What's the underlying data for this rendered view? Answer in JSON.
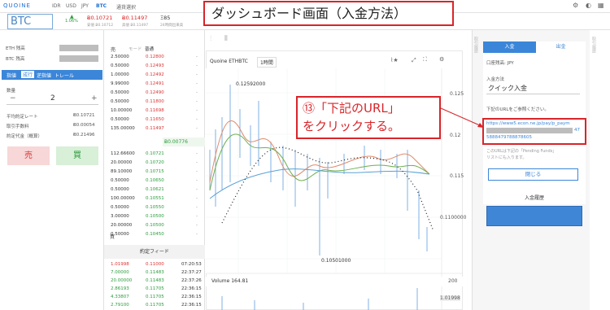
{
  "header": {
    "logo": "QUOINE",
    "currencies": [
      "IDR",
      "USD",
      "JPY",
      "BTC"
    ],
    "pair_select": "通貨選択"
  },
  "ticker": {
    "symbol": "BTC",
    "change": "1.06%",
    "bid": "Ƀ0.10721",
    "ask": "Ƀ0.11497",
    "volume": "Ξ85",
    "bid_sub": "安値 Ƀ0.10712",
    "ask_sub": "高値 Ƀ0.11497",
    "vol_sub": "24時間出来高"
  },
  "annotation_title": "ダッシュボード画面（入金方法）",
  "annotation_13": [
    "⑬「下記のURL」",
    "をクリックする。"
  ],
  "balances": {
    "eth_label": "ETH 残高",
    "btc_label": "BTC 残高"
  },
  "order_tabs": [
    "指値",
    "成行",
    "逆指値",
    "トレール"
  ],
  "quantity": {
    "label": "数量",
    "minus": "−",
    "value": "2",
    "plus": "+"
  },
  "summary": [
    {
      "label": "平均約定レート",
      "value": "Ƀ0.10721"
    },
    {
      "label": "取引手数料",
      "value": "Ƀ0.00054"
    },
    {
      "label": "約定代金（概算）",
      "value": "Ƀ0.21496"
    }
  ],
  "buttons": {
    "sell": "売",
    "buy": "買"
  },
  "orderbook": {
    "sell_label": "売",
    "mode_label": "モード",
    "mode_value": "普通",
    "asks": [
      [
        "2.50000",
        "0.12800"
      ],
      [
        "0.50000",
        "0.12493"
      ],
      [
        "1.00000",
        "0.12492"
      ],
      [
        "9.99000",
        "0.12491"
      ],
      [
        "0.50000",
        "0.12490"
      ],
      [
        "0.50000",
        "0.11800"
      ],
      [
        "10.00000",
        "0.11698"
      ],
      [
        "0.50000",
        "0.11650"
      ],
      [
        "135.00000",
        "0.11497"
      ]
    ],
    "mid": "Ƀ0.00776",
    "bids": [
      [
        "112.66600",
        "0.10721"
      ],
      [
        "20.00000",
        "0.10720"
      ],
      [
        "89.10000",
        "0.10715"
      ],
      [
        "0.50000",
        "0.10650"
      ],
      [
        "0.50000",
        "0.10621"
      ],
      [
        "100.00000",
        "0.10551"
      ],
      [
        "0.50000",
        "0.10550"
      ],
      [
        "3.00000",
        "0.10500"
      ],
      [
        "20.00000",
        "0.10500"
      ],
      [
        "0.50000",
        "0.10450"
      ]
    ],
    "buy_label": "買"
  },
  "feed": {
    "header": "約定フィード",
    "rows": [
      [
        "1.01998",
        "0.11000",
        "07:20:53",
        "sell"
      ],
      [
        "7.00000",
        "0.11483",
        "22:37:27",
        "buy"
      ],
      [
        "20.00000",
        "0.11483",
        "22:37:26",
        "buy"
      ],
      [
        "2.86193",
        "0.11705",
        "22:36:15",
        "buy"
      ],
      [
        "4.33807",
        "0.11705",
        "22:36:15",
        "buy"
      ],
      [
        "2.79100",
        "0.11705",
        "22:36:15",
        "buy"
      ]
    ]
  },
  "chart": {
    "symbol": "Quoine ETHBTC",
    "interval": "1時間",
    "hi_label": "0.12592000",
    "lo_label": "0.10501000",
    "ticks": [
      "0.125",
      "0.12",
      "0.115",
      "0.1100000"
    ],
    "volume_label": "Volume 164.81",
    "vol_tick": "200",
    "last_label": "1.01998"
  },
  "deposit": {
    "tab_deposit": "入金",
    "tab_withdraw": "出金",
    "account_label": "口座残高: JPY",
    "method_label": "入金方法",
    "method_value": "クイック入金",
    "note": "下記のURLをご参照ください。",
    "url": "https://www5.econ.ne.jp/pay/p_paym",
    "url2": "47",
    "url3": "5888479788878605",
    "after_note": "このURLは下記の「Pending Funds」",
    "after_note2": "リストにも入ります。",
    "close": "閉じる",
    "history": "入金履歴"
  }
}
